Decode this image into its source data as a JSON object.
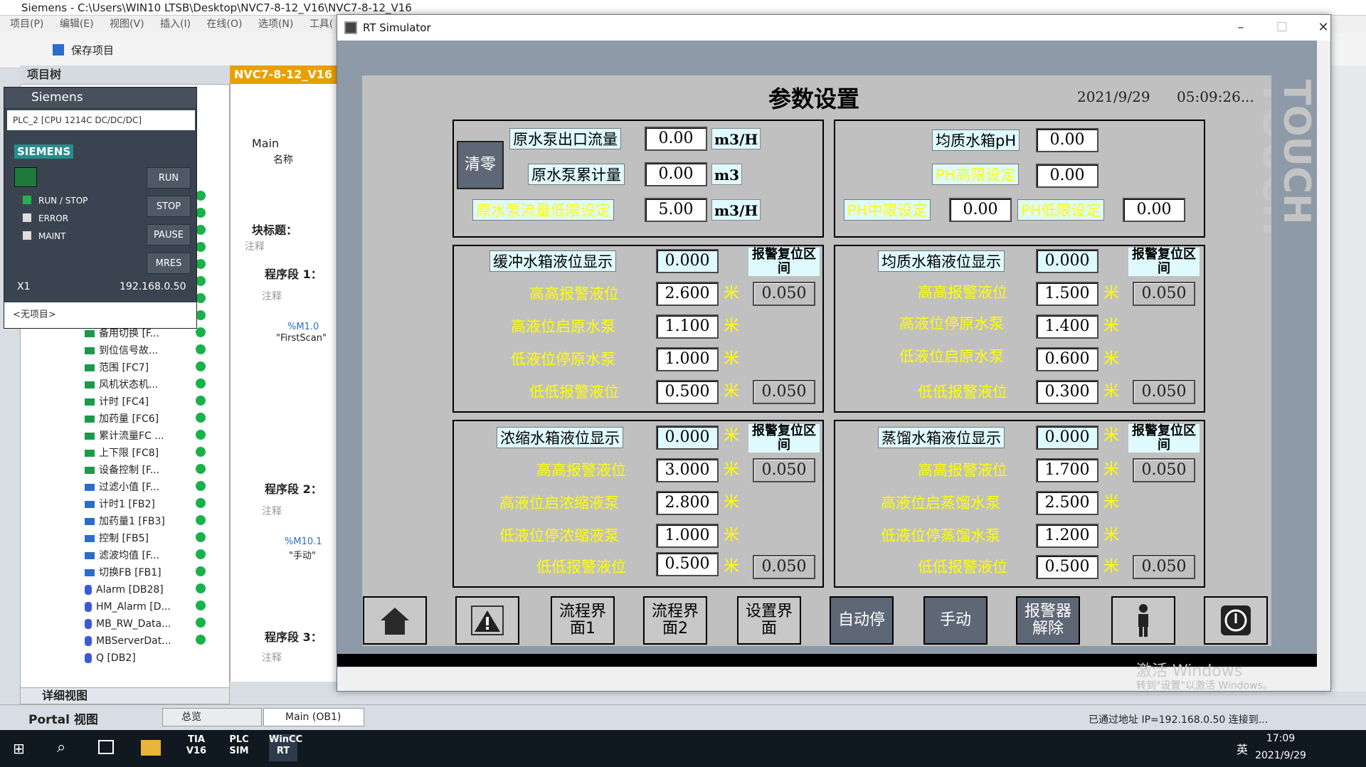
{
  "tia": {
    "window_title": "Siemens - C:\\Users\\WIN10 LTSB\\Desktop\\NVC7-8-12_V16\\NVC7-8-12_V16",
    "menu": [
      "项目(P)",
      "编辑(E)",
      "视图(V)",
      "插入(I)",
      "在线(O)",
      "选项(N)",
      "工具("
    ],
    "save_label": "保存项目",
    "project_tree_label": "项目树",
    "editor_tab": "NVC7-8-12_V16",
    "tree_items": [
      "备用切换 [F...",
      "到位信号故...",
      "范围 [FC7]",
      "风机状态机...",
      "计时 [FC4]",
      "加药量 [FC6]",
      "累计流量FC ...",
      "上下限 [FC8]",
      "设备控制 [F...",
      "过滤小值 [F...",
      "计时1 [FB2]",
      "加药量1 [FB3]",
      "控制 [FB5]",
      "滤波均值 [F...",
      "切换FB [FB1]",
      "Alarm [DB28]",
      "HM_Alarm [D...",
      "MB_RW_Data...",
      "MBServerDat...",
      "Q [DB2]"
    ],
    "detail_view": "详细视图",
    "portal_view": "Portal 视图",
    "overview_tab": "总览",
    "main_tab": "Main (OB1)",
    "connection_status": "已通过地址 IP=192.168.0.50 连接到...",
    "editor_main": "Main",
    "editor_name_col": "名称",
    "block_title": "块标题：",
    "segment1": "程序段 1：",
    "segment2": "程序段 2：",
    "segment3": "程序段 3：",
    "comment": "注释",
    "tag1_addr": "%M1.0",
    "tag1_name": "\"FirstScan\"",
    "tag2_addr": "%M10.1",
    "tag2_name": "\"手动\""
  },
  "plcsim": {
    "title": "Siemens",
    "cpu": "PLC_2 [CPU 1214C DC/DC/DC]",
    "logo": "SIEMENS",
    "run": "RUN",
    "stop": "STOP",
    "pause": "PAUSE",
    "mres": "MRES",
    "led_run_stop": "RUN / STOP",
    "led_error": "ERROR",
    "led_maint": "MAINT",
    "interface": "X1",
    "ip": "192.168.0.50",
    "no_project": "<无项目>"
  },
  "taskbar": {
    "time": "17:09",
    "date": "2021/9/29",
    "ime": "英",
    "apps": [
      "TIA V16",
      "PLC SIM",
      "WinCC RT"
    ]
  },
  "rt": {
    "window_title": "RT Simulator",
    "brand": "TOUCH",
    "watermark_line1": "激活 Windows",
    "watermark_line2": "转到\"设置\"以激活 Windows。"
  },
  "hmi": {
    "title": "参数设置",
    "date": "2021/9/29",
    "time": "05:09:26...",
    "clear_button": "清零",
    "raw_pump": {
      "outlet_flow_label": "原水泵出口流量",
      "outlet_flow_value": "0.00",
      "outlet_flow_unit": "m3/H",
      "total_label": "原水泵累计量",
      "total_value": "0.00",
      "total_unit": "m3",
      "low_limit_label": "原水泵流量低限设定",
      "low_limit_value": "5.00",
      "low_limit_unit": "m3/H"
    },
    "homog_ph": {
      "ph_label": "均质水箱pH",
      "ph_value": "0.00",
      "high_label": "PH高限设定",
      "high_value": "0.00",
      "mid_label": "PH中限设定",
      "mid_value": "0.00",
      "low_label": "PH低限设定",
      "low_value": "0.00"
    },
    "alarm_reset_header": "报警复位区间",
    "unit_m": "米",
    "buffer_tank": {
      "display_label": "缓冲水箱液位显示",
      "display_value": "0.000",
      "hh_label": "高高报警液位",
      "hh_value": "2.600",
      "hh_reset": "0.050",
      "high_label": "高液位启原水泵",
      "high_value": "1.100",
      "low_label": "低液位停原水泵",
      "low_value": "1.000",
      "ll_label": "低低报警液位",
      "ll_value": "0.500",
      "ll_reset": "0.050"
    },
    "homog_tank": {
      "display_label": "均质水箱液位显示",
      "display_value": "0.000",
      "hh_label": "高高报警液位",
      "hh_value": "1.500",
      "hh_reset": "0.050",
      "high_label": "高液位停原水泵",
      "high_value": "1.400",
      "low_label": "低液位启原水泵",
      "low_value": "0.600",
      "ll_label": "低低报警液位",
      "ll_value": "0.300",
      "ll_reset": "0.050"
    },
    "conc_tank": {
      "display_label": "浓缩水箱液位显示",
      "display_value": "0.000",
      "hh_label": "高高报警液位",
      "hh_value": "3.000",
      "hh_reset": "0.050",
      "high_label": "高液位启浓缩液泵",
      "high_value": "2.800",
      "low_label": "低液位停浓缩液泵",
      "low_value": "1.000",
      "ll_label": "低低报警液位",
      "ll_value": "0.500",
      "ll_reset": "0.050"
    },
    "distill_tank": {
      "display_label": "蒸馏水箱液位显示",
      "display_value": "0.000",
      "hh_label": "高高报警液位",
      "hh_value": "1.700",
      "hh_reset": "0.050",
      "high_label": "高液位启蒸馏水泵",
      "high_value": "2.500",
      "low_label": "低液位停蒸馏水泵",
      "low_value": "1.200",
      "ll_label": "低低报警液位",
      "ll_value": "0.500",
      "ll_reset": "0.050"
    },
    "nav": {
      "flow1": "流程界面1",
      "flow2": "流程界面2",
      "settings": "设置界面",
      "auto_stop": "自动停",
      "manual": "手动",
      "alarm_release": "报警器解除"
    }
  }
}
